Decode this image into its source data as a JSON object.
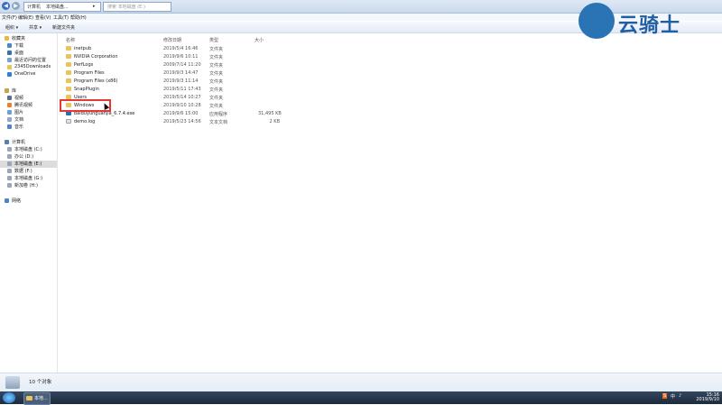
{
  "address_bar": {
    "back_icon": "back-arrow",
    "forward_icon": "forward-arrow",
    "path": [
      "计算机",
      "本地磁盘...",
      "▸"
    ],
    "search_placeholder": "搜索 本地磁盘 (E:)"
  },
  "menu": [
    "文件(F)",
    "编辑(E)",
    "查看(V)",
    "工具(T)",
    "帮助(H)"
  ],
  "commands": [
    "组织 ▾",
    "共享 ▾",
    "新建文件夹"
  ],
  "nav": {
    "favorites_header": "收藏夹",
    "favorites": [
      "下载",
      "桌面",
      "最近访问的位置",
      "2345Downloads",
      "OneDrive"
    ],
    "libraries_header": "库",
    "libraries": [
      "视频",
      "腾讯视频",
      "图片",
      "文档",
      "音乐"
    ],
    "computer_header": "计算机",
    "drives": [
      "本地磁盘 (C:)",
      "办公 (D:)",
      "本地磁盘 (E:)",
      "数据 (F:)",
      "本地磁盘 (G:)",
      "新加卷 (H:)"
    ],
    "selected_drive": "本地磁盘 (E:)",
    "network_header": "网络"
  },
  "columns": {
    "name": "名称",
    "date": "修改日期",
    "type": "类型",
    "size": "大小"
  },
  "files": [
    {
      "name": "inetpub",
      "date": "2019/5/4 16:46",
      "type": "文件夹",
      "size": "",
      "kind": "folder"
    },
    {
      "name": "NVIDIA Corporation",
      "date": "2019/9/6 10:11",
      "type": "文件夹",
      "size": "",
      "kind": "folder"
    },
    {
      "name": "PerfLogs",
      "date": "2009/7/14 11:20",
      "type": "文件夹",
      "size": "",
      "kind": "folder"
    },
    {
      "name": "Program Files",
      "date": "2019/9/3 14:47",
      "type": "文件夹",
      "size": "",
      "kind": "folder"
    },
    {
      "name": "Program Files (x86)",
      "date": "2019/9/3 11:14",
      "type": "文件夹",
      "size": "",
      "kind": "folder"
    },
    {
      "name": "SnapPlugin",
      "date": "2019/5/11 17:43",
      "type": "文件夹",
      "size": "",
      "kind": "folder"
    },
    {
      "name": "Users",
      "date": "2019/5/14 10:27",
      "type": "文件夹",
      "size": "",
      "kind": "folder"
    },
    {
      "name": "Windows",
      "date": "2019/9/10 10:28",
      "type": "文件夹",
      "size": "",
      "kind": "folder"
    },
    {
      "name": "baiduyunguanjia_6.7.4.exe",
      "date": "2019/9/6 15:00",
      "type": "应用程序",
      "size": "31,495 KB",
      "kind": "exe"
    },
    {
      "name": "demo.log",
      "date": "2019/5/23 14:56",
      "type": "文本文档",
      "size": "2 KB",
      "kind": "log"
    }
  ],
  "highlighted_file": "Windows",
  "status": {
    "count_text": "10 个对象"
  },
  "taskbar": {
    "app_label": "本地...",
    "tray_text": "中",
    "clock_time": "15:16",
    "clock_date": "2019/9/10"
  },
  "watermark": {
    "text": "云骑士"
  },
  "colors": {
    "folder": "#e9c458",
    "exe": "#2d6db5",
    "log": "#9aa3ad",
    "highlight": "#e53935",
    "brand": "#1f5fa3"
  }
}
